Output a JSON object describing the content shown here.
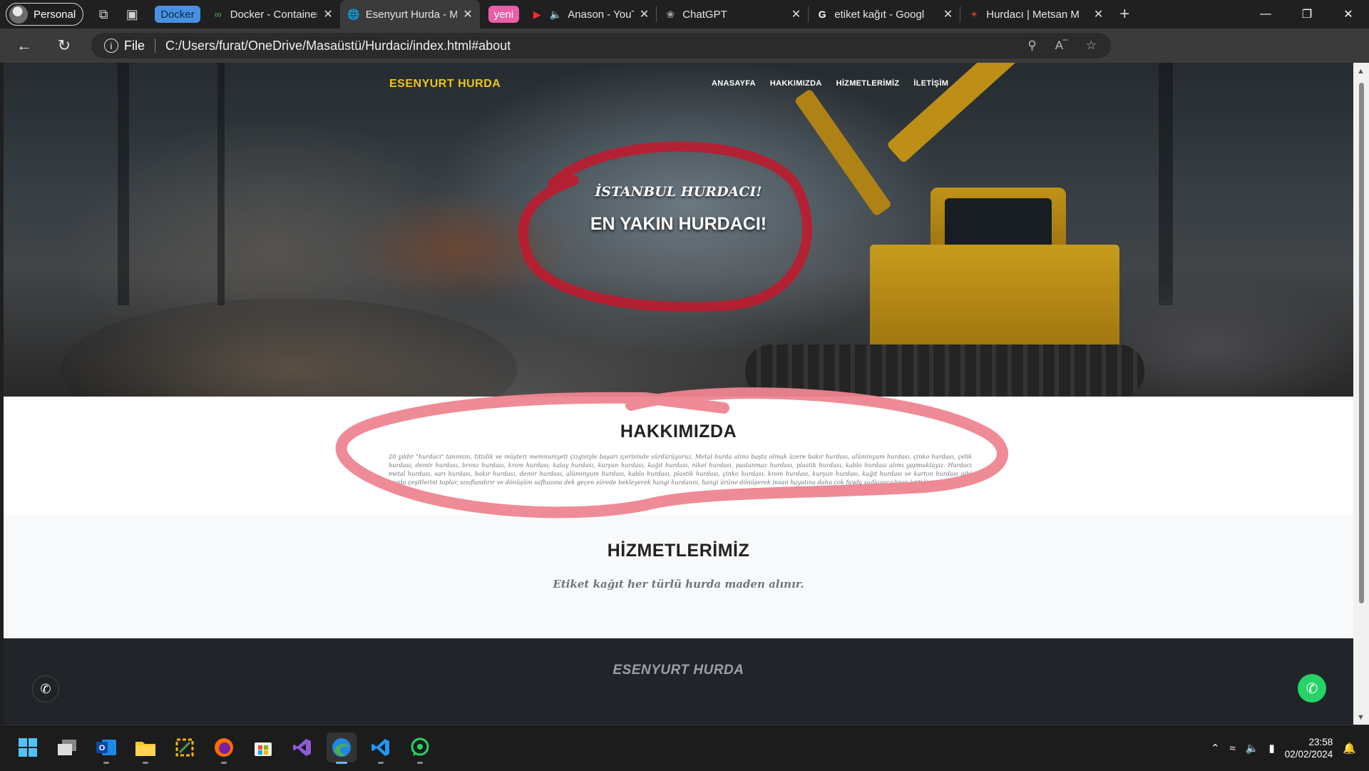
{
  "browser": {
    "profile_label": "Personal",
    "tabs": [
      {
        "group": "Docker",
        "group_color": "#4a90e2",
        "title": "Docker - Container l",
        "favicon": "docker-icon",
        "active": false
      },
      {
        "title": "Esenyurt Hurda - M",
        "favicon": "globe-icon",
        "active": true
      },
      {
        "group": "yeni",
        "group_color": "#e95ea7",
        "title": "Anason - YouTu",
        "favicon": "youtube-icon",
        "audio": true,
        "active": false
      },
      {
        "title": "ChatGPT",
        "favicon": "chatgpt-icon",
        "active": false
      },
      {
        "title": "etiket kağıt - Googl",
        "favicon": "google-icon",
        "active": false
      },
      {
        "title": "Hurdacı | Metsan M",
        "favicon": "metsan-icon",
        "active": false
      }
    ],
    "address": {
      "scheme_label": "File",
      "url": "C:/Users/furat/OneDrive/Masaüstü/Hurdaci/index.html#about"
    }
  },
  "site": {
    "brand": "ESENYURT HURDA",
    "nav": [
      "ANASAYFA",
      "HAKKIMIZDA",
      "HİZMETLERİMİZ",
      "İLETİŞİM"
    ],
    "hero": {
      "subtitle": "İSTANBUL HURDACI!",
      "title": "EN YAKIN HURDACI!"
    },
    "about": {
      "heading": "HAKKIMIZDA",
      "text": "20 yıldır \"hurdacı\" tanımını, titizlik ve müşteri memnuniyeti çizgisiyle başarı içerisinde sürdürüyoruz. Metal hurda alımı başta olmak üzere bakır hurdası, alüminyum hurdası, çinko hurdası, çelik hurdası, demir hurdası, bronz hurdası, krom hurdası, kalay hurdası, kurşun hurdası, kağıt hurdası, nikel hurdası, paslanmaz hurdası, plastik hurdası, kablo hurdası alımı yapmaktayız. Hurdacı metal hurdası, sarı hurdası, bakır hurdası, demir hurdası, alüminyum hurdası, kablo hurdası, plastik hurdası, çinko hurdası, krom hurdası, kurşun hurdası, kağıt hurdası ve karton hurdası gibi hurda çeşitlerini toplar, sınıflandırır ve dönüşüm safhasına dek geçen sürede bekleyerek hangi hurdanın, hangi ürüne dönüşerek insan hayatına daha çok fayda sağlayacağının kritiğini yapar."
    },
    "services": {
      "heading": "HİZMETLERİMİZ",
      "text": "Etiket kağıt her türlü hurda maden alınır."
    },
    "footer": {
      "brand": "ESENYURT HURDA"
    },
    "accent_color": "#f0c419"
  },
  "taskbar": {
    "apps": [
      "windows-start-icon",
      "task-view-icon",
      "outlook-icon",
      "file-explorer-icon",
      "snipping-tool-icon",
      "firefox-icon",
      "microsoft-store-icon",
      "visual-studio-icon",
      "edge-icon",
      "vscode-icon",
      "whatsapp-icon"
    ],
    "clock": {
      "time": "23:58",
      "date": "02/02/2024"
    }
  }
}
